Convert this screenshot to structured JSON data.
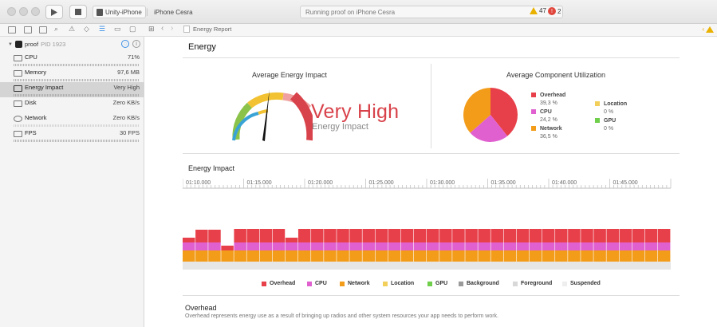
{
  "toolbar": {
    "scheme_target": "Unity-iPhone",
    "scheme_device": "iPhone Cesra",
    "status_text": "Running proof on iPhone Cesra",
    "warnings_count": "47",
    "errors_count": "2"
  },
  "navbar": {
    "breadcrumb": "Energy Report"
  },
  "sidebar": {
    "process_name": "proof",
    "process_pid": "PID 1923",
    "gauges": [
      {
        "label": "CPU",
        "value": "71%",
        "icon": "cpu-icon"
      },
      {
        "label": "Memory",
        "value": "97,6 MB",
        "icon": "memory-icon"
      },
      {
        "label": "Energy Impact",
        "value": "Very High",
        "icon": "battery-icon"
      },
      {
        "label": "Disk",
        "value": "Zero KB/s",
        "icon": "disk-icon"
      },
      {
        "label": "Network",
        "value": "Zero KB/s",
        "icon": "network-icon"
      },
      {
        "label": "FPS",
        "value": "30 FPS",
        "icon": "fps-icon"
      }
    ]
  },
  "main": {
    "title": "Energy",
    "avg_impact_title": "Average Energy Impact",
    "rating": "Very High",
    "rating_sub": "Energy Impact",
    "utilization_title": "Average Component Utilization",
    "components": [
      {
        "name": "Overhead",
        "percent": "39,3 %",
        "color": "#e8404a"
      },
      {
        "name": "CPU",
        "percent": "24,2 %",
        "color": "#e060d0"
      },
      {
        "name": "Network",
        "percent": "36,5 %",
        "color": "#f39c1a"
      },
      {
        "name": "Location",
        "percent": "0 %",
        "color": "#f2cf5a"
      },
      {
        "name": "GPU",
        "percent": "0 %",
        "color": "#6fcf4a"
      }
    ],
    "energy_impact_title": "Energy Impact",
    "time_ticks": [
      "01:10.000",
      "01:15.000",
      "01:20.000",
      "01:25.000",
      "01:30.000",
      "01:35.000",
      "01:40.000",
      "01:45.000"
    ],
    "legend": [
      {
        "label": "Overhead",
        "color": "#e8404a"
      },
      {
        "label": "CPU",
        "color": "#e060d0"
      },
      {
        "label": "Network",
        "color": "#f39c1a"
      },
      {
        "label": "Location",
        "color": "#f2cf5a"
      },
      {
        "label": "GPU",
        "color": "#6fcf4a"
      },
      {
        "label": "Background",
        "color": "#9a9a9a"
      },
      {
        "label": "Foreground",
        "color": "#d8d8d8"
      },
      {
        "label": "Suspended",
        "color": "#eeeeee"
      }
    ],
    "overhead_title": "Overhead",
    "overhead_desc": "Overhead represents energy use as a result of bringing up radios and other system resources your app needs to perform work."
  }
}
